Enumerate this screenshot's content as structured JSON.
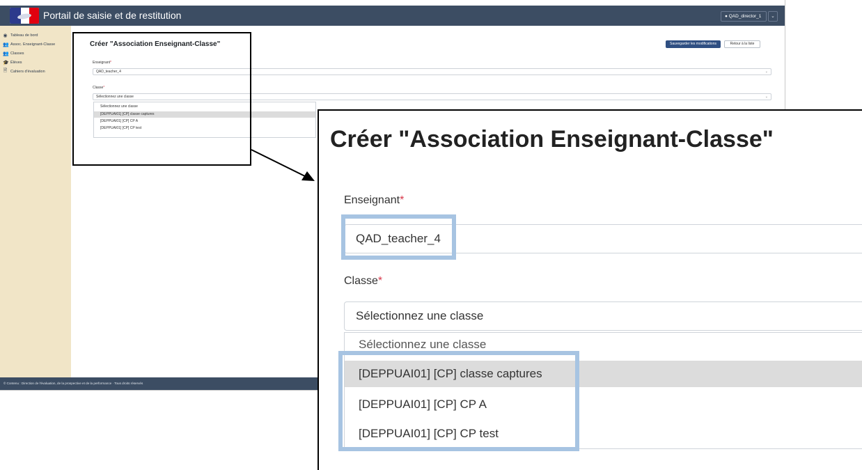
{
  "app": {
    "title": "Portail de saisie et de restitution",
    "user_label": "QAD_director_1",
    "user_caret": "⌄",
    "footer": "© Contenu : Direction de l'évaluation, de la prospective et de la performance · Tous droits réservés"
  },
  "sidebar": {
    "items": [
      {
        "label": "Tableau de bord",
        "icon": "dashboard-icon",
        "glyph": "◉"
      },
      {
        "label": "Assoc. Enseignant-Classe",
        "icon": "users-icon",
        "glyph": "👥"
      },
      {
        "label": "Classes",
        "icon": "group-icon",
        "glyph": "👥"
      },
      {
        "label": "Élèves",
        "icon": "students-icon",
        "glyph": "🎓"
      },
      {
        "label": "Cahiers d'évaluation",
        "icon": "document-icon",
        "glyph": "🗎"
      }
    ]
  },
  "form": {
    "title": "Créer \"Association Enseignant-Classe\"",
    "save_label": "Sauvegarder les modifications",
    "back_label": "Retour à la liste",
    "teacher_label": "Enseignant",
    "teacher_value": "QAD_teacher_4",
    "classe_label": "Classe",
    "classe_placeholder": "Sélectionnez une classe",
    "required_mark": "*",
    "chevron": "⌄",
    "options": [
      "Sélectionnez une classe",
      "[DEPPUAI01] [CP] classe captures",
      "[DEPPUAI01] [CP] CP A",
      "[DEPPUAI01] [CP] CP test"
    ],
    "selected_index": 1
  },
  "colors": {
    "topbar": "#3c4d63",
    "sidebar": "#f1e5c7",
    "primary_button": "#2f4f82",
    "highlight": "#a7c4e2",
    "required": "#d8394b"
  }
}
